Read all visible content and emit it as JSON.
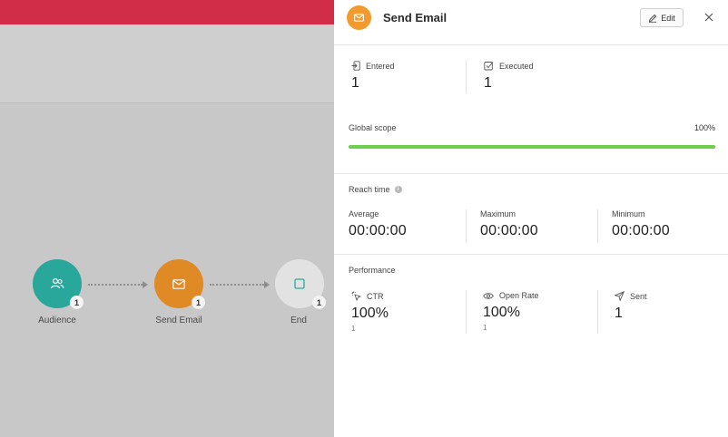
{
  "flow": {
    "nodes": [
      {
        "label": "Audience",
        "count": "1",
        "color": "#2aa79b",
        "icon": "users-icon"
      },
      {
        "label": "Send Email",
        "count": "1",
        "color": "#e08a25",
        "icon": "mail-icon"
      },
      {
        "label": "End",
        "count": "1",
        "color": "#e2e2e2",
        "icon": "square-icon"
      }
    ]
  },
  "panel": {
    "title": "Send Email",
    "edit_label": "Edit",
    "stats": {
      "entered": {
        "label": "Entered",
        "value": "1"
      },
      "executed": {
        "label": "Executed",
        "value": "1"
      }
    },
    "global_scope": {
      "label": "Global scope",
      "percent_text": "100%",
      "fraction": 1.0,
      "color": "#6fcf4a"
    },
    "reach_time": {
      "label": "Reach time",
      "average": {
        "label": "Average",
        "value": "00:00:00"
      },
      "maximum": {
        "label": "Maximum",
        "value": "00:00:00"
      },
      "minimum": {
        "label": "Minimum",
        "value": "00:00:00"
      }
    },
    "performance": {
      "label": "Performance",
      "ctr": {
        "label": "CTR",
        "value": "100%",
        "sub": "1"
      },
      "open_rate": {
        "label": "Open Rate",
        "value": "100%",
        "sub": "1"
      },
      "sent": {
        "label": "Sent",
        "value": "1"
      }
    }
  },
  "colors": {
    "topbar": "#d12c48",
    "accent": "#f29a2e"
  }
}
